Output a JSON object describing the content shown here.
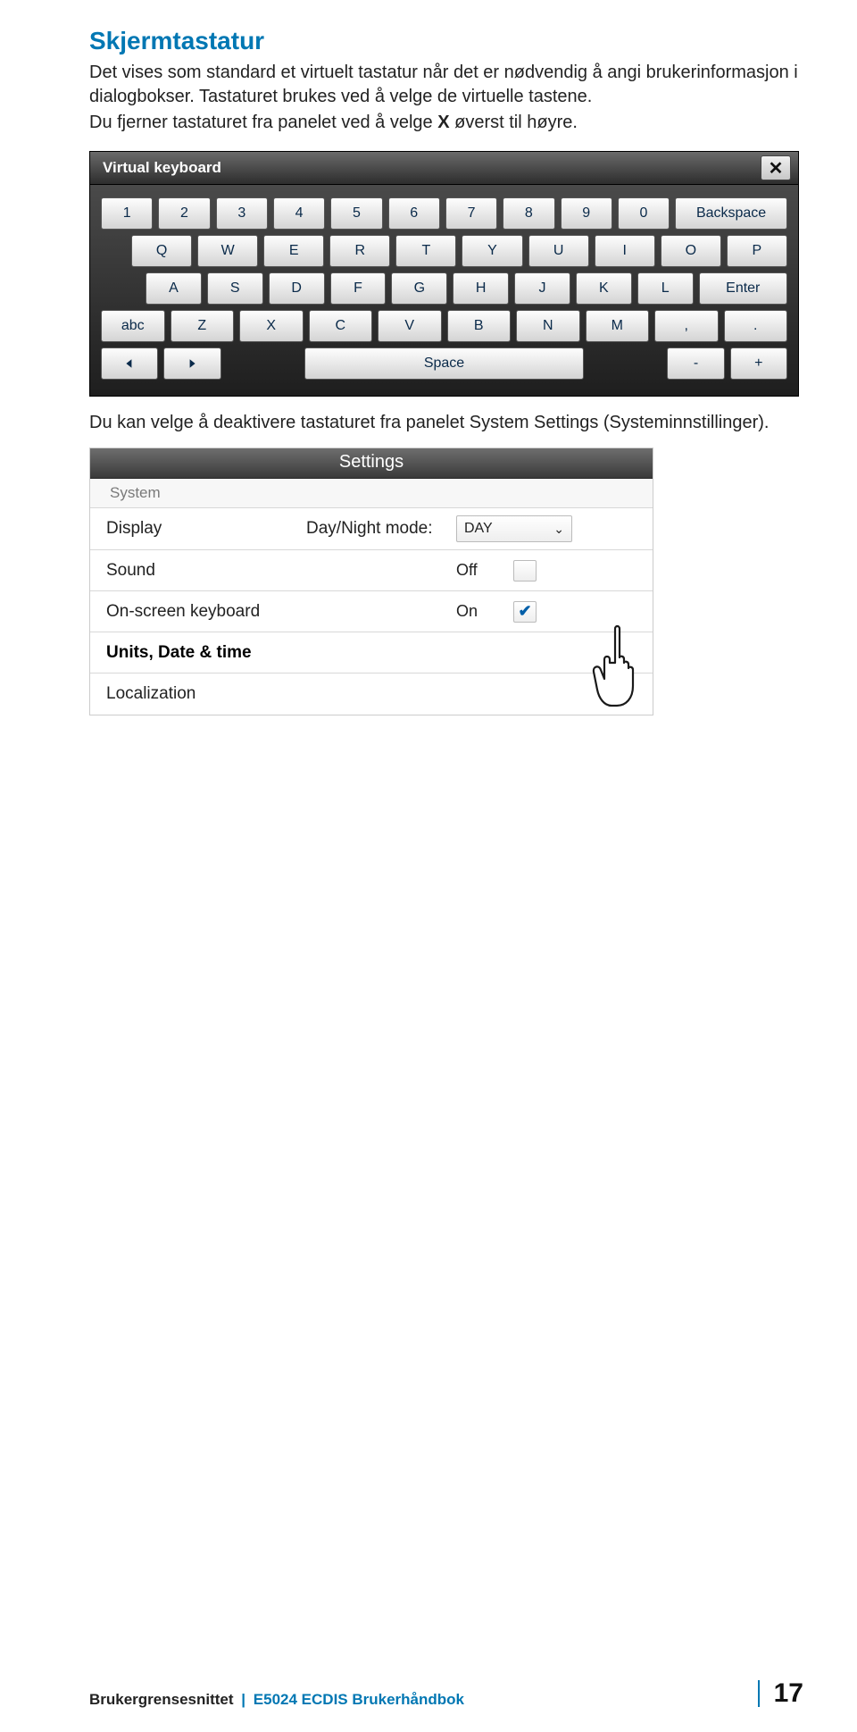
{
  "heading": "Skjermtastatur",
  "paragraphs": {
    "p1": "Det vises som standard et virtuelt tastatur når det er nødvendig å angi brukerinformasjon i dialogbokser. Tastaturet brukes ved å velge de virtuelle tastene.",
    "p2a": "Du fjerner tastaturet fra panelet ved å velge ",
    "p2b": "X",
    "p2c": " øverst til høyre.",
    "after_kb": "Du kan velge å deaktivere tastaturet fra panelet System Settings (Systeminnstillinger)."
  },
  "vk": {
    "title": "Virtual keyboard",
    "close": "✕",
    "row1": [
      "1",
      "2",
      "3",
      "4",
      "5",
      "6",
      "7",
      "8",
      "9",
      "0",
      "Backspace"
    ],
    "row2": [
      "Q",
      "W",
      "E",
      "R",
      "T",
      "Y",
      "U",
      "I",
      "O",
      "P"
    ],
    "row3": [
      "A",
      "S",
      "D",
      "F",
      "G",
      "H",
      "J",
      "K",
      "L",
      "Enter"
    ],
    "row4": [
      "abc",
      "Z",
      "X",
      "C",
      "V",
      "B",
      "N",
      "M",
      ",",
      "."
    ],
    "row5": {
      "space": "Space",
      "minus": "-",
      "plus": "+"
    }
  },
  "settings": {
    "title": "Settings",
    "group": "System",
    "rows": {
      "display": {
        "label": "Display",
        "sublabel": "Day/Night mode:",
        "value": "DAY"
      },
      "sound": {
        "label": "Sound",
        "value": "Off"
      },
      "osk": {
        "label": "On-screen keyboard",
        "value": "On"
      },
      "units": {
        "label": "Units, Date & time"
      },
      "loc": {
        "label": "Localization"
      }
    }
  },
  "footer": {
    "section": "Brukergrensesnittet",
    "sep": "|",
    "doc": "E5024 ECDIS Brukerhåndbok",
    "page": "17"
  }
}
